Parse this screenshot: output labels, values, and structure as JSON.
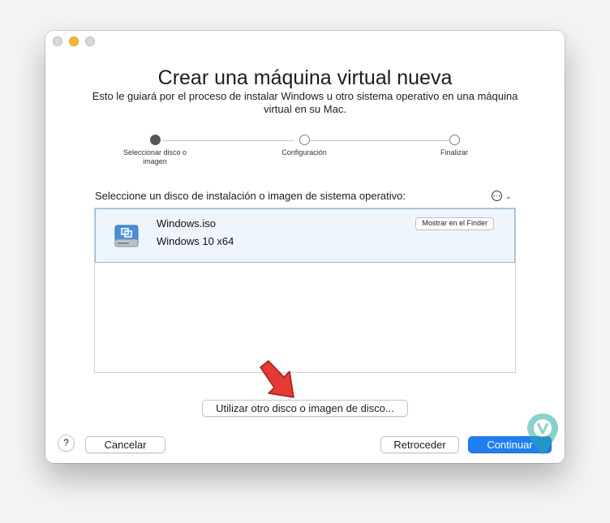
{
  "window": {
    "title": "Crear una máquina virtual nueva",
    "subtitle": "Esto le guiará por el proceso de instalar Windows u otro sistema operativo en una máquina virtual en su Mac."
  },
  "steps": [
    {
      "label": "Seleccionar disco o imagen",
      "state": "active"
    },
    {
      "label": "Configuración",
      "state": "pending"
    },
    {
      "label": "Finalizar",
      "state": "pending"
    }
  ],
  "disk_list": {
    "header": "Seleccione un disco de instalación o imagen de sistema operativo:",
    "items": [
      {
        "name": "Windows.iso",
        "os": "Windows 10 x64",
        "action_label": "Mostrar en el Finder",
        "icon": "disk-image-icon"
      }
    ]
  },
  "buttons": {
    "other_disk": "Utilizar otro disco o imagen de disco...",
    "help": "?",
    "cancel": "Cancelar",
    "back": "Retroceder",
    "continue": "Continuar"
  },
  "colors": {
    "accent": "#1e7ef2",
    "selection": "#eef5fc",
    "arrow": "#e53935",
    "watermark": "#2aa9a4"
  }
}
